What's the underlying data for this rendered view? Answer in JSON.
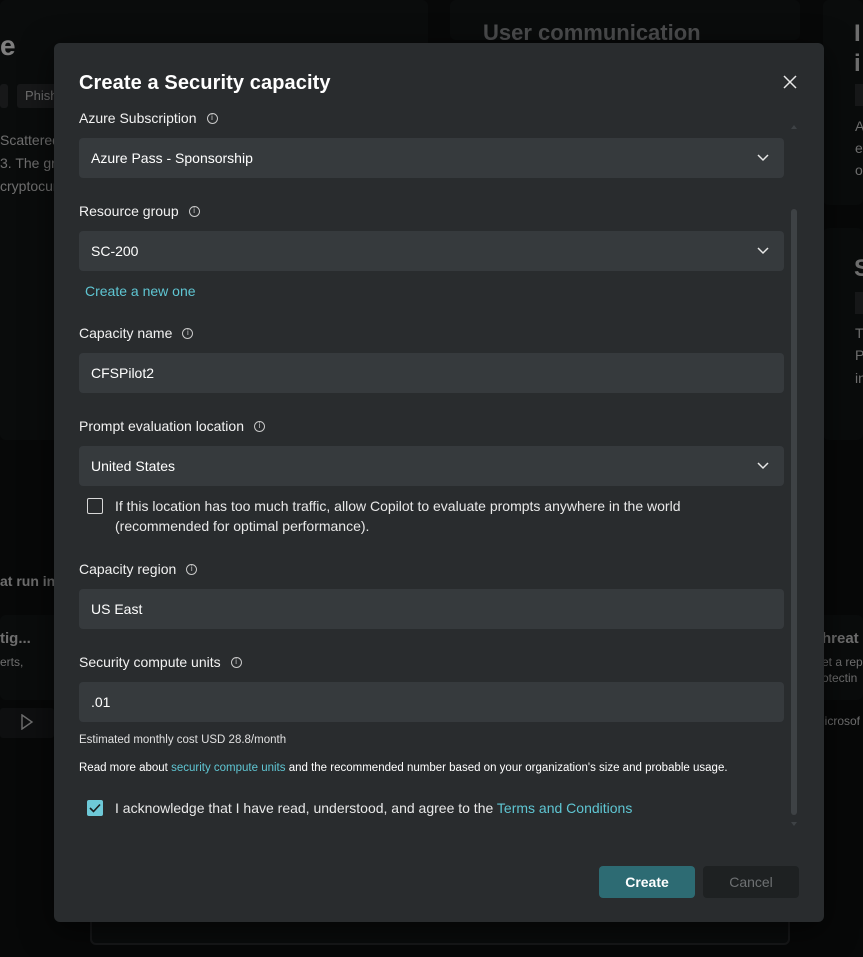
{
  "background": {
    "heading_fragment_left": "e",
    "tag_left": "Phish",
    "text_left_1": "Scattered",
    "text_left_2": "3. The gro",
    "text_left_3": "cryptocur",
    "section_heading_center": "User communication",
    "heading_fragment_right_1": "I",
    "heading_fragment_right_2": "i",
    "text_right_1": "A",
    "text_right_2": "e",
    "text_right_3": "o",
    "heading_fragment_right_3": "S",
    "text_right_4": "T",
    "text_right_5": "P",
    "text_right_6": "in",
    "text_mid_left": "at run in",
    "card_left_title": "tig...",
    "card_left_sub": "erts,",
    "card_right_title": "hreat",
    "card_right_sub1": "et a rep",
    "card_right_sub2": "otectin",
    "card_right_link": "licrosof"
  },
  "dialog": {
    "title": "Create a Security capacity",
    "close_label": "Close",
    "azure_subscription": {
      "label": "Azure Subscription",
      "value": "Azure Pass - Sponsorship"
    },
    "resource_group": {
      "label": "Resource group",
      "value": "SC-200",
      "create_link": "Create a new one"
    },
    "capacity_name": {
      "label": "Capacity name",
      "value": "CFSPilot2"
    },
    "prompt_location": {
      "label": "Prompt evaluation location",
      "value": "United States",
      "checkbox_line1": "If this location has too much traffic, allow Copilot to evaluate prompts anywhere in the world",
      "checkbox_line2": "(recommended for optimal performance).",
      "checked": false
    },
    "capacity_region": {
      "label": "Capacity region",
      "value": "US East"
    },
    "compute_units": {
      "label": "Security compute units",
      "value": ".01",
      "cost_note": "Estimated monthly cost USD 28.8/month",
      "read_more_prefix": "Read more about",
      "read_more_link": "security compute units",
      "read_more_suffix": "and the recommended number based on your organization's size and probable usage."
    },
    "terms": {
      "prefix": "I acknowledge that I have read, understood, and agree to the",
      "link": "Terms and Conditions",
      "checked": true
    },
    "buttons": {
      "create": "Create",
      "cancel": "Cancel"
    }
  },
  "colors": {
    "accent": "#5fc6d3",
    "primary_button": "#2d6b73",
    "dialog_bg": "#292c2e",
    "field_bg": "#363a3d"
  }
}
